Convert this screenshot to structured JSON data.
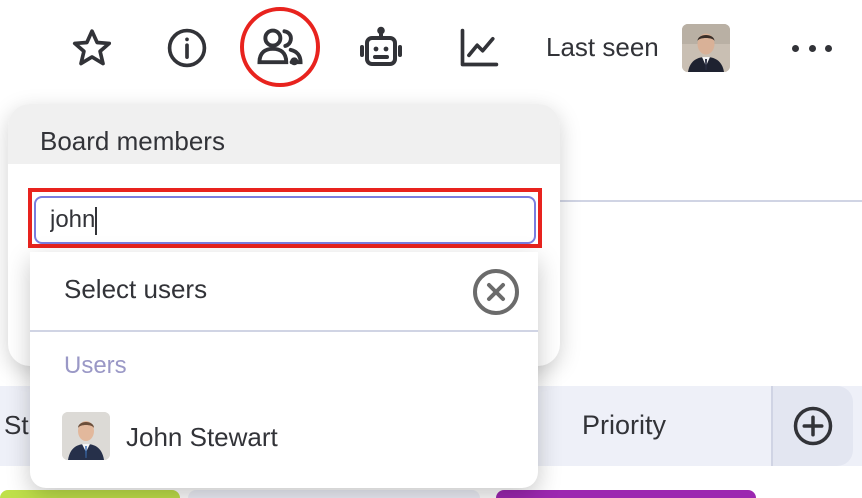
{
  "toolbar": {
    "icons": [
      "star-icon",
      "info-icon",
      "board-members-icon",
      "automations-robot-icon",
      "activity-chart-icon",
      "more-icon"
    ],
    "last_seen_label": "Last seen"
  },
  "board": {
    "column_partial_label": "St",
    "priority_label": "Priority",
    "add_column_icon": "plus-circle-icon"
  },
  "popover": {
    "title": "Board members",
    "search_value": "john",
    "dropdown": {
      "title": "Select users",
      "section_label": "Users",
      "users": [
        {
          "name": "John Stewart"
        }
      ]
    }
  },
  "colors": {
    "highlight": "#e8231e",
    "input_border": "#7a7de0",
    "section_label": "#9a98c6",
    "text": "#323338"
  }
}
